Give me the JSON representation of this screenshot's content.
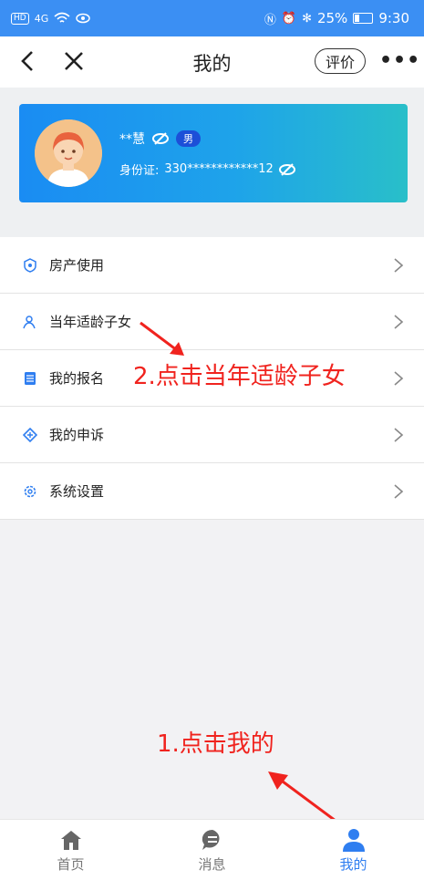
{
  "status_bar": {
    "hd": "HD",
    "signal": "4G",
    "battery": "25%",
    "time": "9:30"
  },
  "nav": {
    "title": "我的",
    "rate_label": "评价",
    "more": "•••"
  },
  "profile": {
    "name": "**慧",
    "gender": "男",
    "id_label": "身份证:",
    "id_value": "330************12"
  },
  "menu": [
    {
      "label": "房产使用",
      "icon": "house-shield-icon"
    },
    {
      "label": "当年适龄子女",
      "icon": "children-icon"
    },
    {
      "label": "我的报名",
      "icon": "registration-icon"
    },
    {
      "label": "我的申诉",
      "icon": "appeal-icon"
    },
    {
      "label": "系统设置",
      "icon": "settings-icon"
    }
  ],
  "annotations": {
    "step2": "2.点击当年适龄子女",
    "step1": "1.点击我的"
  },
  "tabs": [
    {
      "label": "首页",
      "icon": "home-icon",
      "active": false
    },
    {
      "label": "消息",
      "icon": "message-icon",
      "active": false
    },
    {
      "label": "我的",
      "icon": "user-icon",
      "active": true
    }
  ],
  "colors": {
    "accent": "#2f7ef0",
    "status_bar": "#3b8ff3",
    "annotation": "#f0231e"
  }
}
